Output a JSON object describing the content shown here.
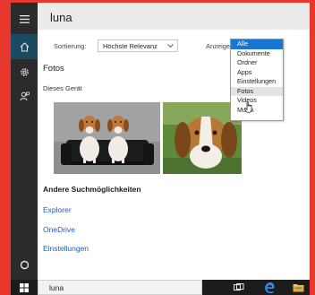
{
  "search": {
    "query": "luna"
  },
  "filters": {
    "sort_label": "Sortierung:",
    "sort_value": "Höchste Relevanz",
    "show_label": "Anzeigen:",
    "show_options": [
      "Alle",
      "Dokumente",
      "Ordner",
      "Apps",
      "Einstellungen",
      "Fotos",
      "Videos",
      "Musik"
    ],
    "show_selected": "Alle",
    "show_hovered": "Fotos"
  },
  "results": {
    "section_title": "Fotos",
    "subtitle": "Dieses Gerät"
  },
  "more": {
    "title": "Andere Suchmöglichkeiten",
    "links": [
      "Explorer",
      "OneDrive",
      "Einstellungen"
    ]
  },
  "taskbar": {
    "search_text": "luna"
  },
  "colors": {
    "accent": "#1976d2",
    "link": "#1a5fb4",
    "rail_bg": "#2b2b2b",
    "rail_active": "#1a4b63",
    "frame": "#e8382e"
  },
  "icons": {
    "menu": "hamburger-menu-icon",
    "home": "home-icon",
    "settings": "gear-icon",
    "feedback": "feedback-person-icon",
    "cortana": "cortana-circle-icon",
    "start": "windows-logo-icon",
    "task_view": "task-view-icon",
    "edge": "edge-browser-icon",
    "explorer": "file-explorer-icon"
  }
}
